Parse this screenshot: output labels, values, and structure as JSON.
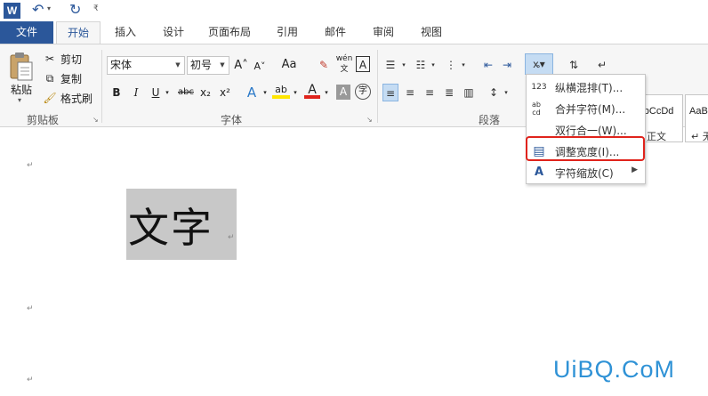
{
  "quick_access": {
    "app_icon": "W",
    "undo_glyph": "↶",
    "redo_glyph": "↻",
    "dropdown_glyph": "▾",
    "customize_glyph": "₹"
  },
  "tabs": [
    {
      "label": "文件"
    },
    {
      "label": "开始"
    },
    {
      "label": "插入"
    },
    {
      "label": "设计"
    },
    {
      "label": "页面布局"
    },
    {
      "label": "引用"
    },
    {
      "label": "邮件"
    },
    {
      "label": "审阅"
    },
    {
      "label": "视图"
    }
  ],
  "clipboard": {
    "paste_label": "粘贴",
    "cut_label": "剪切",
    "copy_label": "复制",
    "format_painter_label": "格式刷",
    "group_label": "剪贴板"
  },
  "font": {
    "font_name": "宋体",
    "font_size": "初号",
    "grow_label": "A˄",
    "shrink_label": "A˅",
    "change_case_label": "Aa",
    "phonetic_label": "wén文",
    "border_label": "A",
    "bold": "B",
    "italic": "I",
    "underline": "U",
    "strike": "abc",
    "subscript": "x₂",
    "superscript": "x²",
    "effects": "A",
    "highlight": "ab",
    "color": "A",
    "shade": "A",
    "enclose": "字",
    "group_label": "字体"
  },
  "paragraph": {
    "group_label": "段落"
  },
  "styles": {
    "normal_sample": "AaBbCcDd",
    "normal_name": "正文",
    "next_sample": "AaBb",
    "next_name": "↵ 无"
  },
  "menu": {
    "items": [
      {
        "icon": "123",
        "label": "纵横混排(T)..."
      },
      {
        "icon": "abcd",
        "label": "合并字符(M)..."
      },
      {
        "icon": "",
        "label": "双行合一(W)..."
      },
      {
        "icon": "▤",
        "label": "调整宽度(I)..."
      },
      {
        "icon": "A",
        "label": "字符缩放(C)"
      }
    ]
  },
  "document": {
    "text": "文字",
    "para_mark": "↵"
  },
  "watermark": "UiBQ.CoM",
  "colors": {
    "accent": "#2b579a",
    "highlight_border": "#e0231c",
    "watermark": "#2f92d6"
  }
}
